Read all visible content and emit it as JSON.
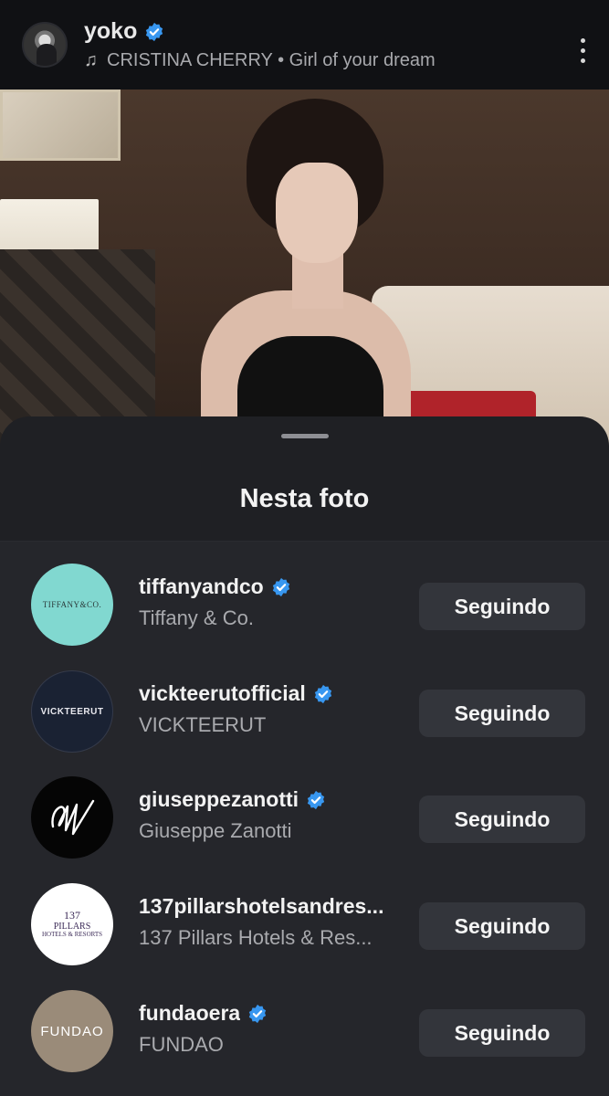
{
  "header": {
    "username": "yoko",
    "music_label": "CRISTINA CHERRY • Girl of your dream",
    "music_icon": "music-note-icon",
    "more_icon": "more-vertical-icon"
  },
  "sheet": {
    "title": "Nesta foto"
  },
  "accounts": [
    {
      "handle": "tiffanyandco",
      "name": "Tiffany & Co.",
      "button": "Seguindo",
      "logo_text": "TIFFANY&CO.",
      "verified": true
    },
    {
      "handle": "vickteerutofficial",
      "name": "VICKTEERUT",
      "button": "Seguindo",
      "logo_text": "VICKTEERUT",
      "verified": true
    },
    {
      "handle": "giuseppezanotti",
      "name": "Giuseppe Zanotti",
      "button": "Seguindo",
      "logo_text": "GZ",
      "verified": true
    },
    {
      "handle": "137pillarshotelsandres...",
      "name": "137 Pillars Hotels & Res...",
      "button": "Seguindo",
      "logo_text": "137",
      "logo_text2": "PILLARS",
      "logo_text3": "HOTELS & RESORTS",
      "verified": false
    },
    {
      "handle": "fundaoera",
      "name": "FUNDAO",
      "button": "Seguindo",
      "logo_text": "FUNDAO",
      "verified": true
    }
  ],
  "colors": {
    "verified_badge": "#3897f0",
    "sheet_bg": "#1f2024",
    "button_bg": "#33353b"
  }
}
